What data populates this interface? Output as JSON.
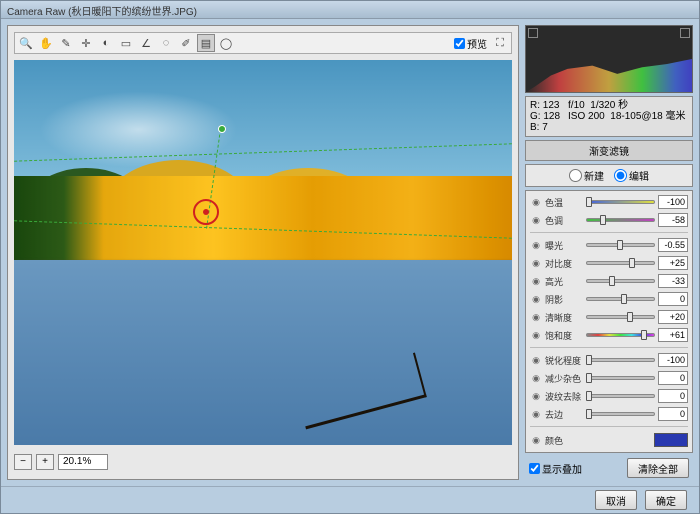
{
  "window": {
    "title": "Camera Raw (秋日暖阳下的缤纷世界.JPG)"
  },
  "toolbar": {
    "preview_label": "预览"
  },
  "zoom": {
    "value": "20.1%"
  },
  "info": {
    "r_label": "R:",
    "g_label": "G:",
    "b_label": "B:",
    "r": "123",
    "g": "128",
    "b": "7",
    "aperture": "f/10",
    "shutter": "1/320 秒",
    "iso": "ISO 200",
    "lens": "18-105@18 毫米"
  },
  "panel": {
    "title": "渐变滤镜",
    "radio_new": "新建",
    "radio_edit": "编辑"
  },
  "sliders": {
    "temp": {
      "label": "色温",
      "value": "-100",
      "pos": 0
    },
    "tint": {
      "label": "色调",
      "value": "-58",
      "pos": 21
    },
    "exposure": {
      "label": "曝光",
      "value": "-0.55",
      "pos": 45
    },
    "contrast": {
      "label": "对比度",
      "value": "+25",
      "pos": 62
    },
    "highlights": {
      "label": "高光",
      "value": "-33",
      "pos": 33
    },
    "shadows": {
      "label": "阴影",
      "value": "0",
      "pos": 50
    },
    "clarity": {
      "label": "清晰度",
      "value": "+20",
      "pos": 60
    },
    "saturation": {
      "label": "饱和度",
      "value": "+61",
      "pos": 80
    },
    "sharpness": {
      "label": "锐化程度",
      "value": "-100",
      "pos": 0
    },
    "noise": {
      "label": "减少杂色",
      "value": "0",
      "pos": 0
    },
    "moire": {
      "label": "波纹去除",
      "value": "0",
      "pos": 0
    },
    "defringe": {
      "label": "去边",
      "value": "0",
      "pos": 0
    },
    "color": {
      "label": "颜色",
      "swatch": "#2838b0"
    }
  },
  "overlay": {
    "show_label": "显示叠加",
    "clear_label": "清除全部"
  },
  "footer": {
    "cancel": "取消",
    "ok": "确定"
  }
}
